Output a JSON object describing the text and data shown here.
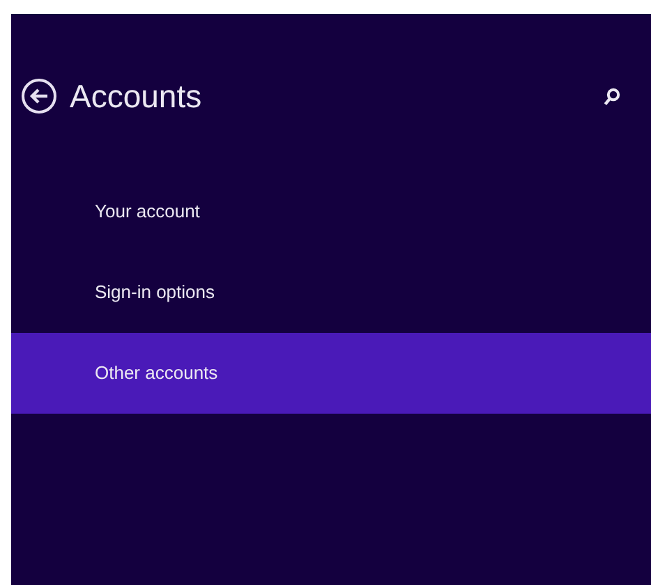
{
  "header": {
    "title": "Accounts"
  },
  "items": [
    {
      "label": "Your account",
      "selected": false
    },
    {
      "label": "Sign-in options",
      "selected": false
    },
    {
      "label": "Other accounts",
      "selected": true
    }
  ]
}
